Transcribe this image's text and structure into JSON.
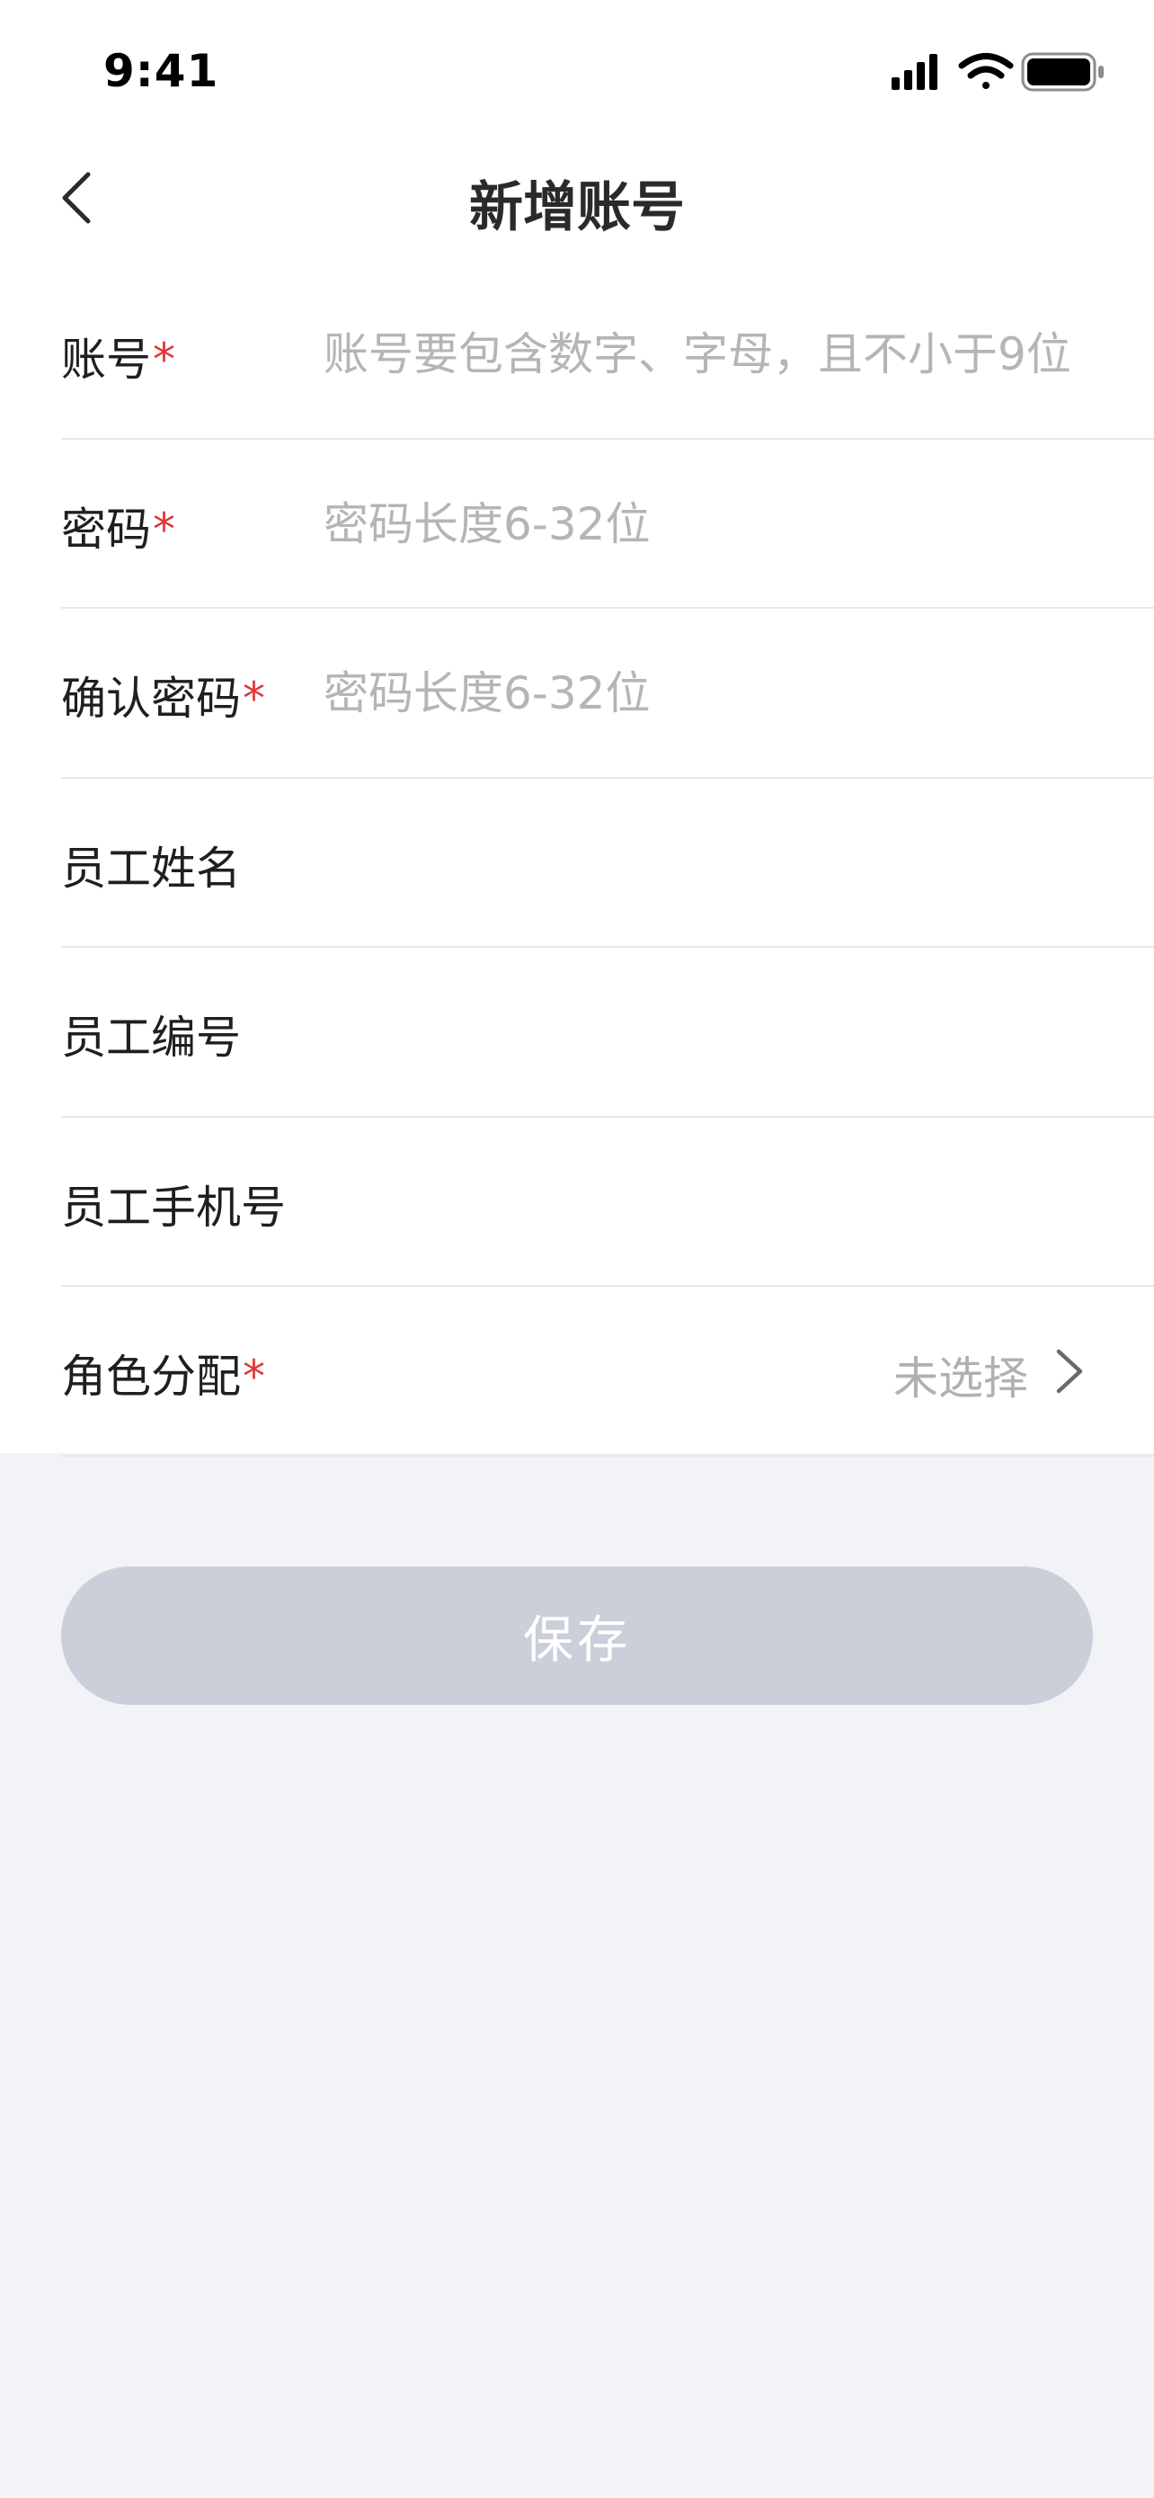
{
  "status_bar": {
    "time": "9:41",
    "icons": [
      "signal-icon",
      "wifi-icon",
      "battery-icon"
    ]
  },
  "nav": {
    "back_icon": "chevron-left-icon",
    "title": "新增账号"
  },
  "form": {
    "required_mark": "*",
    "fields": [
      {
        "label": "账号",
        "required": true,
        "placeholder": "账号要包含数字、字母，且不小于9位",
        "value": ""
      },
      {
        "label": "密码",
        "required": true,
        "placeholder": "密码长度6-32位",
        "value": ""
      },
      {
        "label": "确认密码",
        "required": true,
        "placeholder": "密码长度6-32位",
        "value": ""
      },
      {
        "label": "员工姓名",
        "required": false,
        "placeholder": "",
        "value": ""
      },
      {
        "label": "员工编号",
        "required": false,
        "placeholder": "",
        "value": ""
      },
      {
        "label": "员工手机号",
        "required": false,
        "placeholder": "",
        "value": ""
      }
    ],
    "role": {
      "label": "角色分配",
      "required": true,
      "value": "未选择",
      "icon": "chevron-right-icon"
    }
  },
  "actions": {
    "save_label": "保存"
  },
  "colors": {
    "background": "#f2f3f7",
    "required": "#e0373a",
    "placeholder": "#b5b5b5",
    "button_disabled": "#cbcfd9"
  }
}
